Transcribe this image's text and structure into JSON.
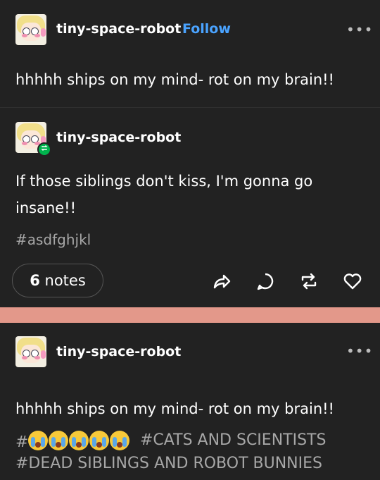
{
  "post1": {
    "username": "tiny-space-robot",
    "follow_label": "Follow",
    "more_label": "•••",
    "text": "hhhhh ships on my mind- rot on my brain!!"
  },
  "reblog": {
    "username": "tiny-space-robot",
    "text": "If those siblings don't kiss, I'm gonna go insane!!",
    "tag": "#asdfghjkl",
    "notes_count": "6",
    "notes_label": "notes"
  },
  "post2": {
    "username": "tiny-space-robot",
    "more_label": "•••",
    "text": "hhhhh ships on my mind- rot on my brain!!",
    "tags": {
      "emoji_tag_prefix": "#",
      "cats_tag": "#CATS AND SCIENTISTS",
      "dead_siblings_tag": "#DEAD SIBLINGS AND ROBOT BUNNIES"
    }
  },
  "icons": [
    "share-icon",
    "reply-icon",
    "reblog-icon",
    "like-icon",
    "more-icon",
    "reblog-badge-icon"
  ],
  "colors": {
    "background": "#222222",
    "follow": "#4aa3ff",
    "tag": "#a7a7a7",
    "separator": "#e3988a",
    "reblog_badge": "#00b34d"
  }
}
